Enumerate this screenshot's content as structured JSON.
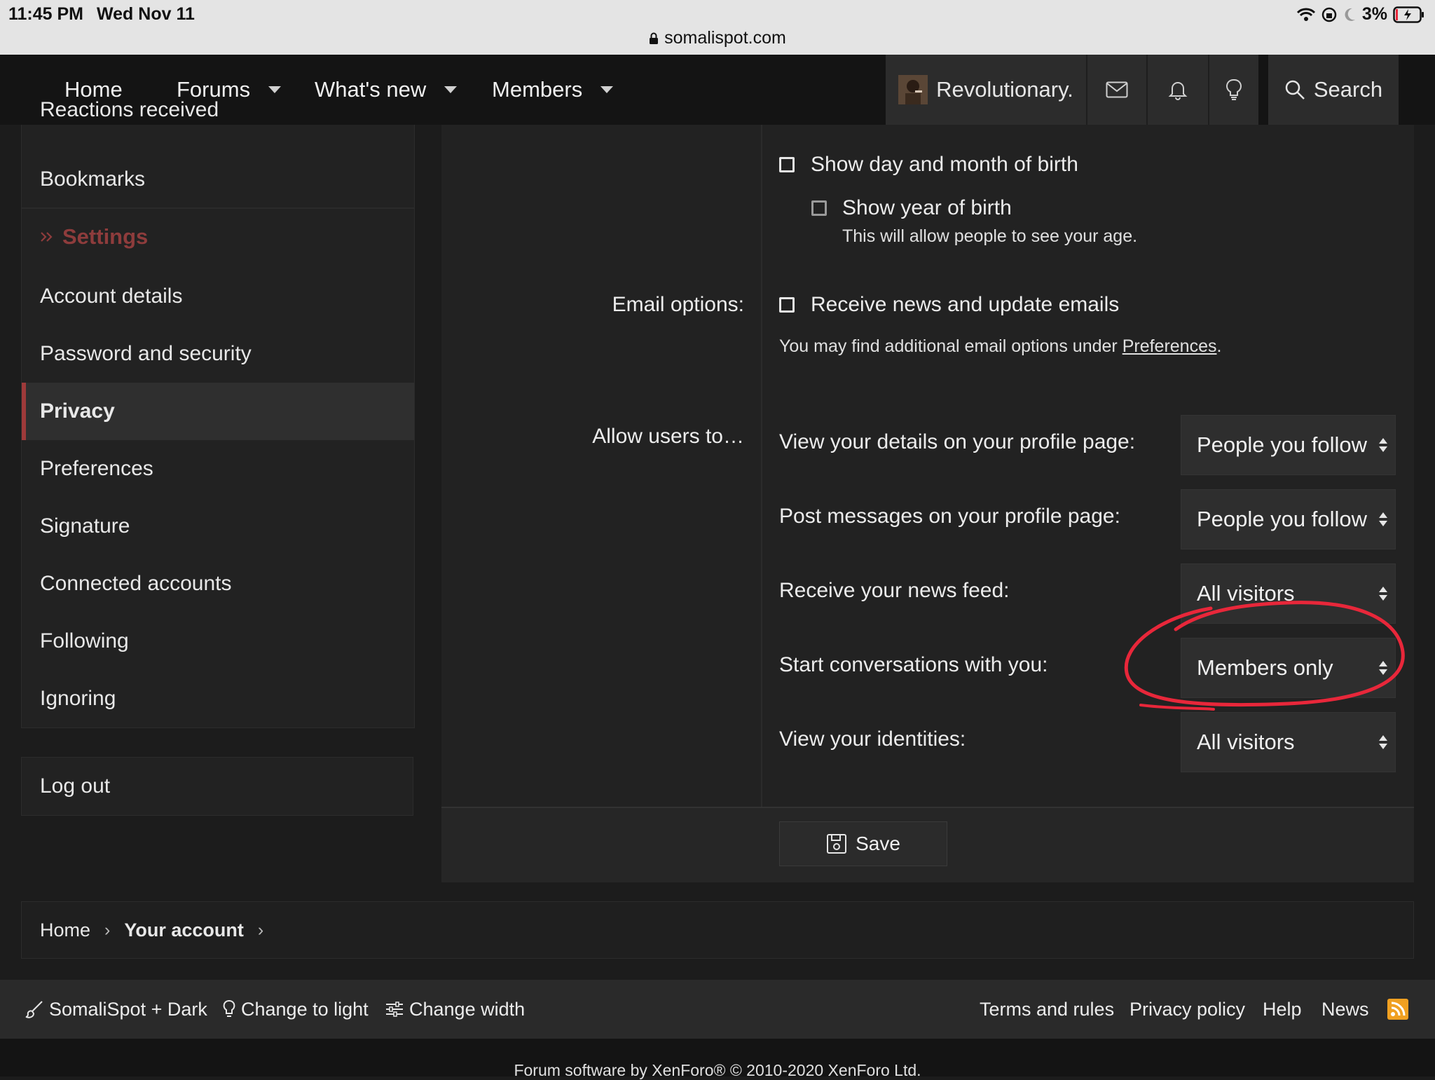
{
  "status_bar": {
    "time": "11:45 PM",
    "date": "Wed Nov 11",
    "battery": "3%",
    "url": "somalispot.com"
  },
  "nav": {
    "home": "Home",
    "forums": "Forums",
    "whats_new": "What's new",
    "members": "Members",
    "username": "Revolutionary.",
    "search": "Search"
  },
  "sidebar": {
    "partial_item": "Reactions received",
    "bookmarks": "Bookmarks",
    "settings_heading": "Settings",
    "items": [
      "Account details",
      "Password and security",
      "Privacy",
      "Preferences",
      "Signature",
      "Connected accounts",
      "Following",
      "Ignoring"
    ],
    "logout": "Log out"
  },
  "form": {
    "show_birth_day": "Show day and month of birth",
    "show_birth_year": "Show year of birth",
    "birth_year_hint": "This will allow people to see your age.",
    "email_label": "Email options:",
    "receive_news": "Receive news and update emails",
    "email_hint_prefix": "You may find additional email options under ",
    "email_hint_link": "Preferences",
    "email_hint_suffix": ".",
    "allow_label": "Allow users to…",
    "rows": [
      {
        "label": "View your details on your profile page:",
        "value": "People you follow"
      },
      {
        "label": "Post messages on your profile page:",
        "value": "People you follow"
      },
      {
        "label": "Receive your news feed:",
        "value": "All visitors"
      },
      {
        "label": "Start conversations with you:",
        "value": "Members only"
      },
      {
        "label": "View your identities:",
        "value": "All visitors"
      }
    ],
    "save": "Save"
  },
  "breadcrumb": {
    "home": "Home",
    "current": "Your account"
  },
  "footer": {
    "style": "SomaliSpot + Dark",
    "change_light": "Change to light",
    "change_width": "Change width",
    "terms": "Terms and rules",
    "privacy": "Privacy policy",
    "help": "Help",
    "news": "News",
    "copyright": "Forum software by XenForo® © 2010-2020 XenForo Ltd."
  },
  "colors": {
    "accent": "#9e3a3a",
    "annotation": "#e8273a",
    "rss": "#f0a021"
  }
}
